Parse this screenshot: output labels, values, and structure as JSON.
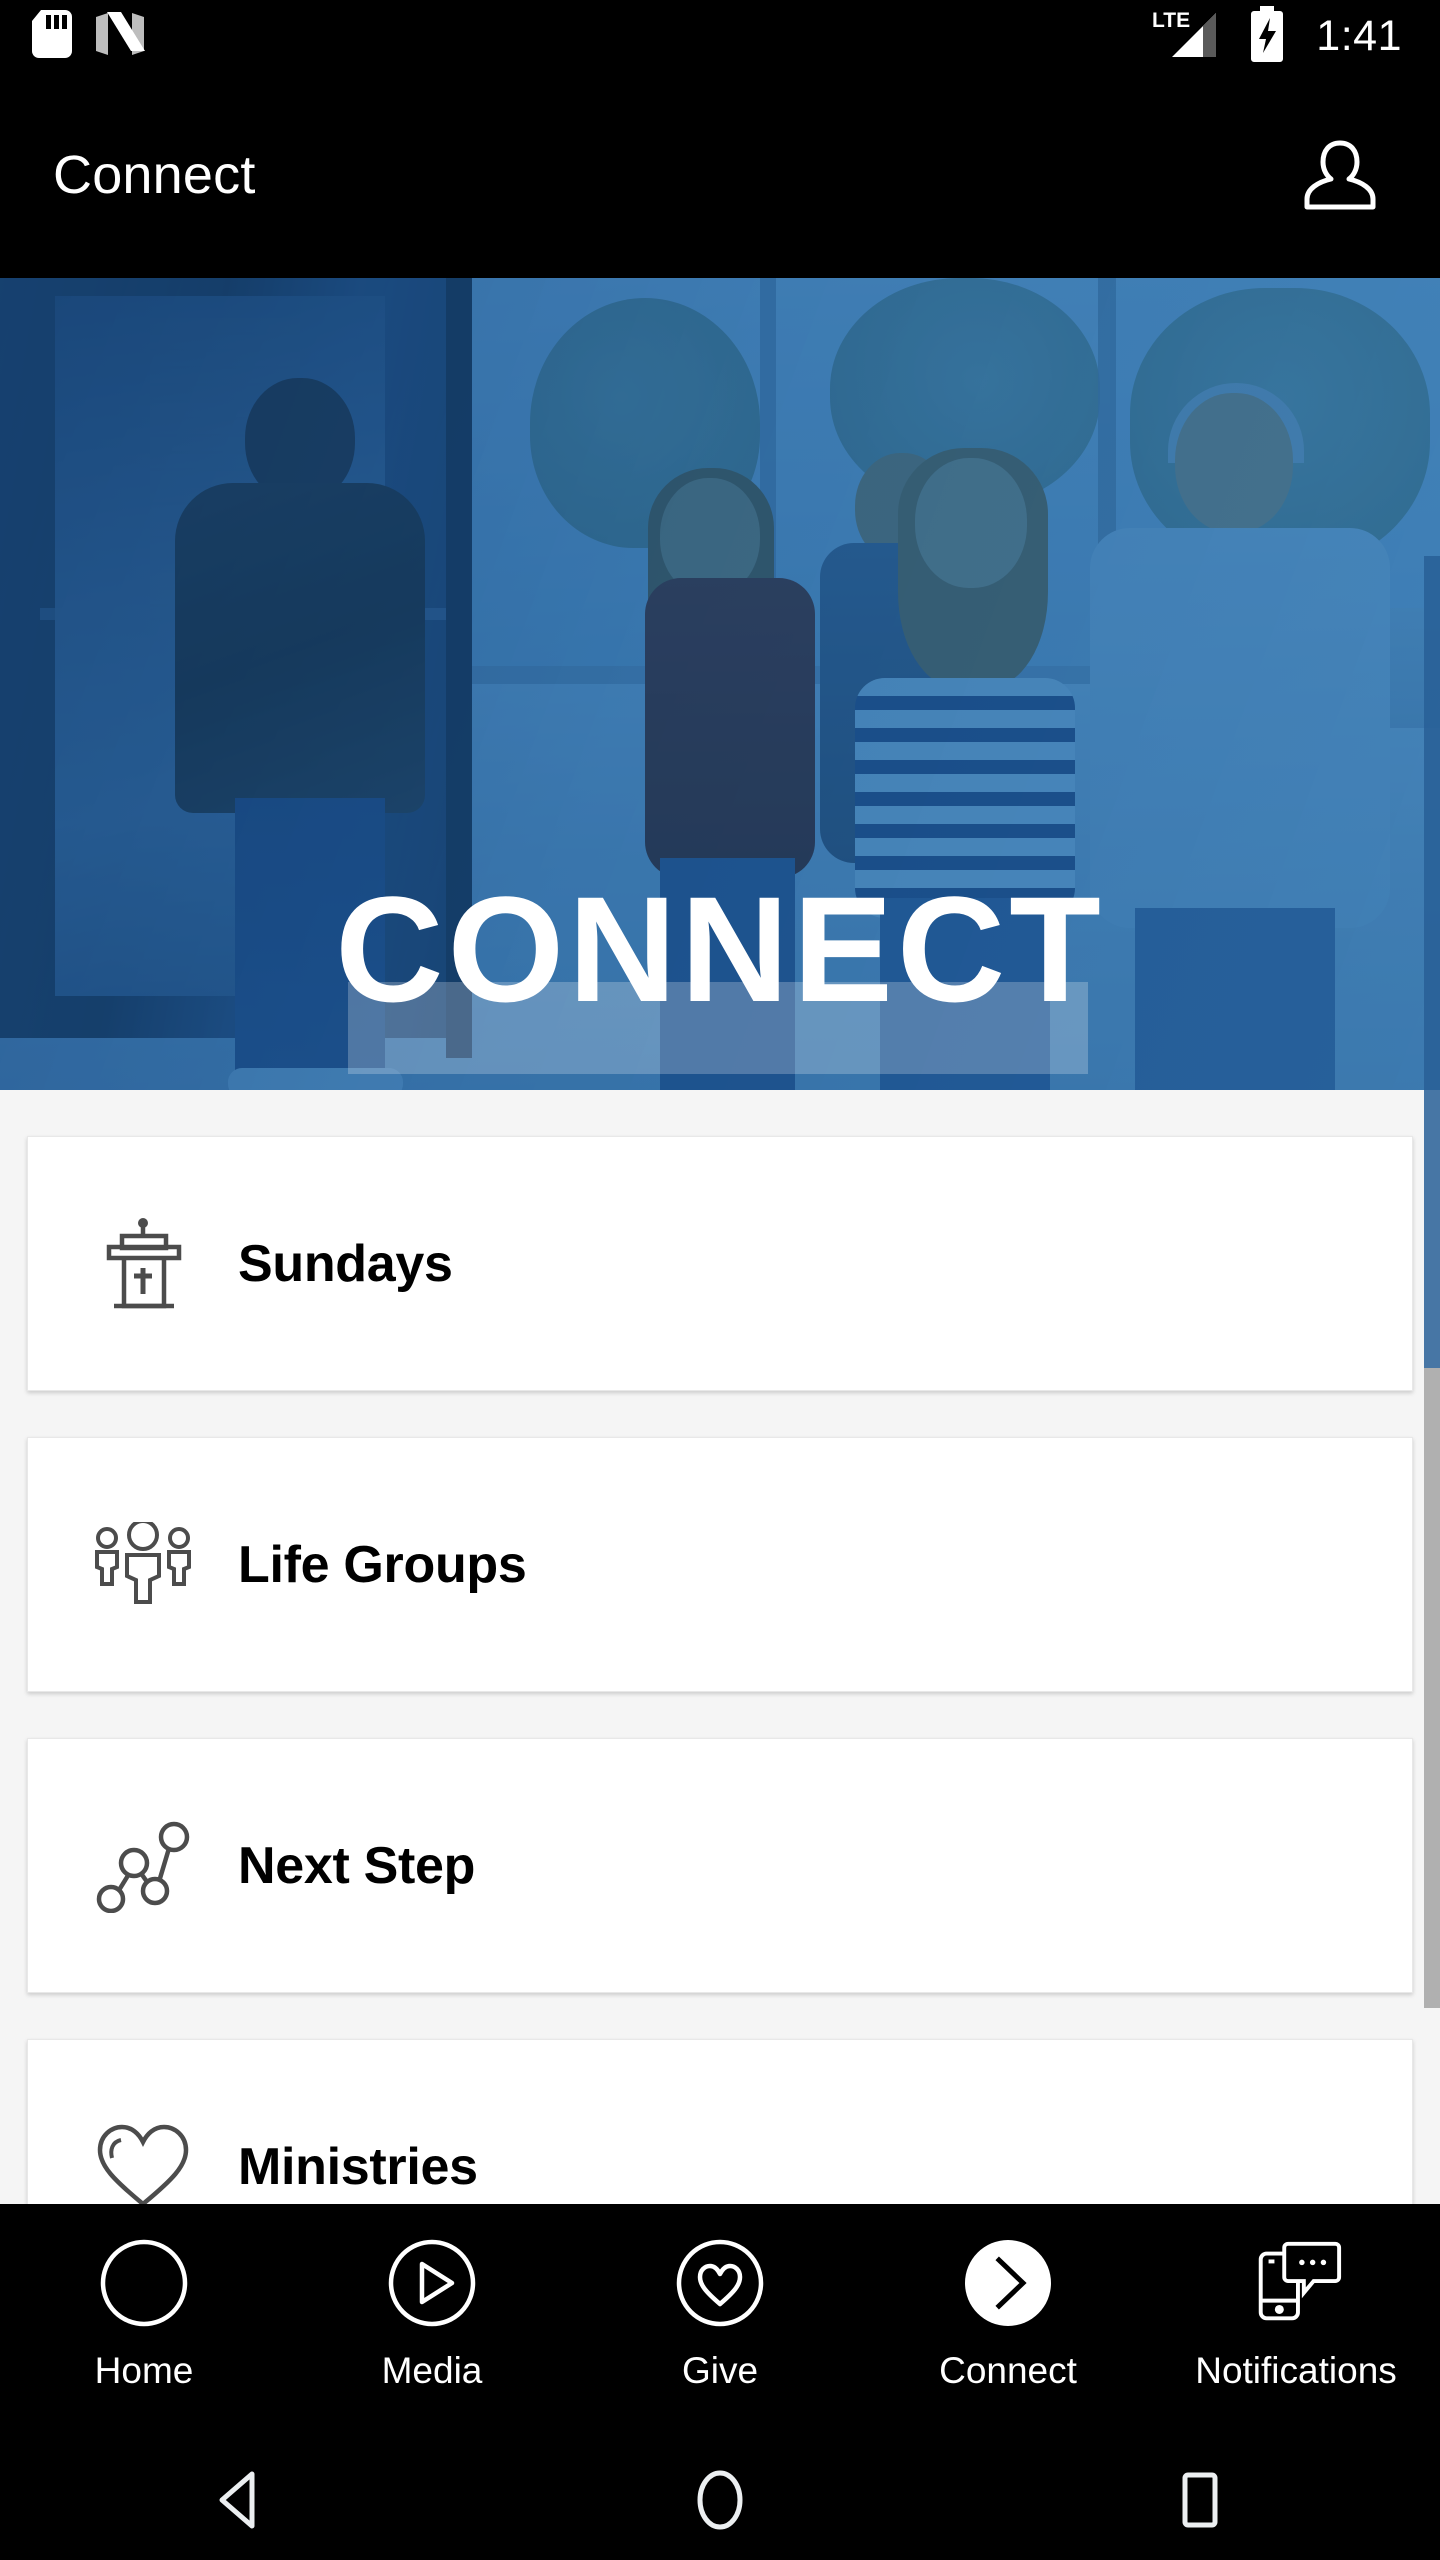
{
  "status_bar": {
    "left_icons": [
      "sd-card-icon",
      "android-nougat-icon"
    ],
    "right_icons": [
      "lte-signal-icon",
      "battery-charging-icon"
    ],
    "network_label": "LTE",
    "clock": "1:41"
  },
  "app_bar": {
    "title": "Connect",
    "profile_icon": "person-icon"
  },
  "hero": {
    "title": "CONNECT",
    "overlay_color": "#2470af",
    "photo_alt": "people walking through church entry doors"
  },
  "cards": [
    {
      "label": "Sundays",
      "icon": "pulpit-icon"
    },
    {
      "label": "Life Groups",
      "icon": "people-group-icon"
    },
    {
      "label": "Next Step",
      "icon": "node-path-icon"
    },
    {
      "label": "Ministries",
      "icon": "heart-outline-icon"
    }
  ],
  "tab_bar": {
    "tabs": [
      {
        "label": "Home",
        "icon": "circle-outline-icon",
        "active": false
      },
      {
        "label": "Media",
        "icon": "play-circle-icon",
        "active": false
      },
      {
        "label": "Give",
        "icon": "heart-circle-icon",
        "active": false
      },
      {
        "label": "Connect",
        "icon": "chevron-right-circle-filled-icon",
        "active": true
      },
      {
        "label": "Notifications",
        "icon": "phone-message-icon",
        "active": false
      }
    ]
  },
  "android_nav": {
    "buttons": [
      "back-triangle-icon",
      "home-circle-icon",
      "recents-square-icon"
    ]
  },
  "colors": {
    "accent_blue": "#2470af",
    "page_background": "#f5f5f5",
    "card_background": "#ffffff",
    "bar_background": "#000000",
    "icon_gray": "#4c4c4c",
    "scrollbar_gray": "#b0b0b0"
  }
}
